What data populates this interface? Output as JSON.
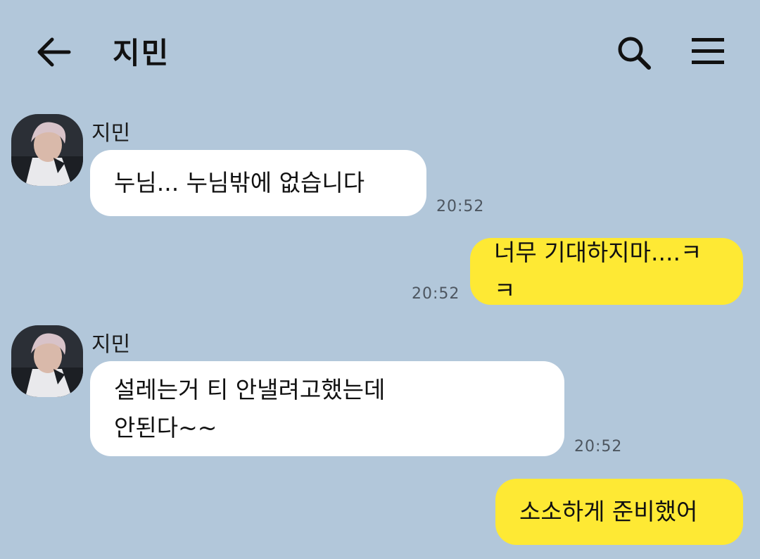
{
  "header": {
    "title": "지민",
    "icons": [
      "back-arrow-icon",
      "search-icon",
      "hamburger-menu-icon"
    ]
  },
  "colors": {
    "background": "#b2c7da",
    "incoming_bubble": "#ffffff",
    "outgoing_bubble": "#fee934"
  },
  "messages": [
    {
      "direction": "incoming",
      "sender": "지민",
      "text": "누님... 누님밖에 없습니다",
      "time": "20:52"
    },
    {
      "direction": "outgoing",
      "text": "너무 기대하지마....ㅋㅋ",
      "time": "20:52"
    },
    {
      "direction": "incoming",
      "sender": "지민",
      "lines": [
        "설레는거 티 안낼려고했는데",
        "안된다~~"
      ],
      "time": "20:52"
    },
    {
      "direction": "outgoing",
      "text": "소소하게 준비했어"
    }
  ]
}
